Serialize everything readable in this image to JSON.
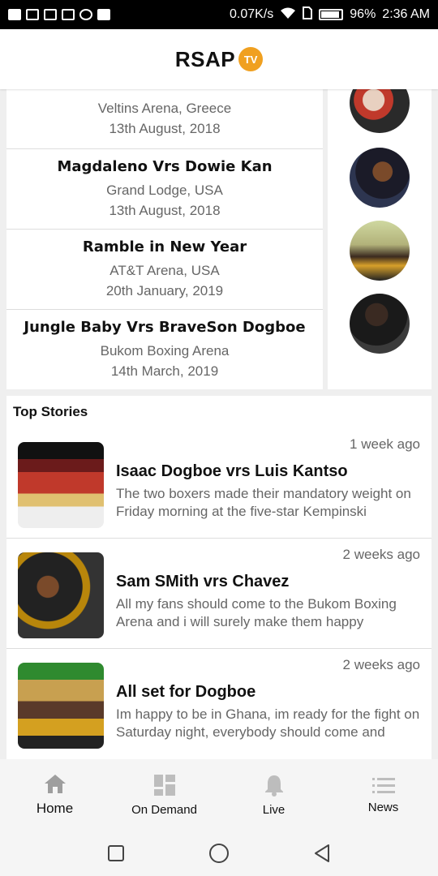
{
  "status_bar": {
    "speed": "0.07K/s",
    "battery": "96%",
    "time": "2:36 AM"
  },
  "header": {
    "logo_text": "RSAP",
    "logo_badge": "TV",
    "brand_color": "#f0a020"
  },
  "events": [
    {
      "title": "",
      "venue": "Veltins Arena, Greece",
      "date": "13th August, 2018"
    },
    {
      "title": "Magdaleno Vrs Dowie Kan",
      "venue": "Grand Lodge, USA",
      "date": "13th August, 2018"
    },
    {
      "title": "Ramble in New Year",
      "venue": "AT&T Arena, USA",
      "date": "20th January, 2019"
    },
    {
      "title": "Jungle Baby Vrs BraveSon Dogboe",
      "venue": "Bukom Boxing Arena",
      "date": "14th March, 2019"
    }
  ],
  "top_stories": {
    "heading": "Top Stories",
    "items": [
      {
        "time": "1 week ago",
        "title": "Isaac Dogboe vrs Luis Kantso",
        "summary": "The two boxers made their mandatory weight on Friday morning at the five-star Kempinski"
      },
      {
        "time": "2 weeks ago",
        "title": "Sam SMith vrs Chavez",
        "summary": "All my fans should come to the Bukom Boxing Arena and i will surely make them happy"
      },
      {
        "time": "2 weeks ago",
        "title": "All set for Dogboe",
        "summary": "Im happy to be in Ghana, im ready for the fight on Saturday night, everybody should come and"
      }
    ]
  },
  "bottom_nav": [
    {
      "label": "Home",
      "icon": "home-icon",
      "active": true
    },
    {
      "label": "On Demand",
      "icon": "dashboard-icon",
      "active": false
    },
    {
      "label": "Live",
      "icon": "bell-icon",
      "active": false
    },
    {
      "label": "News",
      "icon": "list-icon",
      "active": false
    }
  ]
}
